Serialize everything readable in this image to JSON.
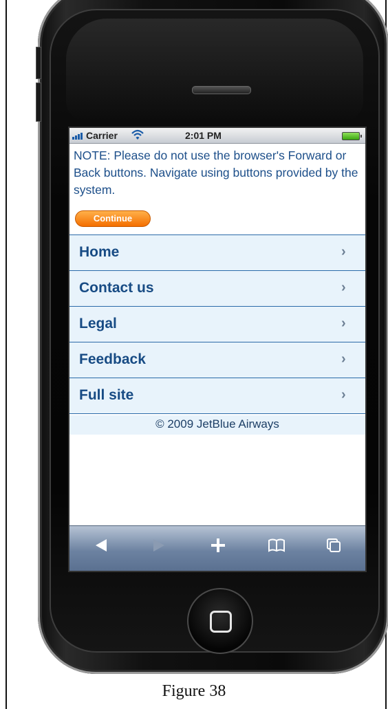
{
  "status_bar": {
    "carrier": "Carrier",
    "time": "2:01 PM"
  },
  "notice": {
    "text": "NOTE: Please do not use the browser's Forward or Back buttons. Navigate using buttons provided by the system.",
    "continue_label": "Continue"
  },
  "menu": {
    "items": [
      {
        "label": "Home",
        "chevron": "›"
      },
      {
        "label": "Contact us",
        "chevron": "›"
      },
      {
        "label": "Legal",
        "chevron": "›"
      },
      {
        "label": "Feedback",
        "chevron": "›"
      },
      {
        "label": "Full site",
        "chevron": "›"
      }
    ]
  },
  "footer": {
    "copyright": "© 2009 JetBlue Airways"
  },
  "toolbar": {
    "icons": [
      "back-arrow-icon",
      "forward-arrow-icon",
      "plus-icon",
      "bookmarks-icon",
      "pages-icon"
    ]
  },
  "figure": {
    "caption": "Figure 38"
  },
  "colors": {
    "link_blue": "#174b84",
    "menu_bg": "#e8f3fb",
    "continue_orange": "#f46e00"
  }
}
